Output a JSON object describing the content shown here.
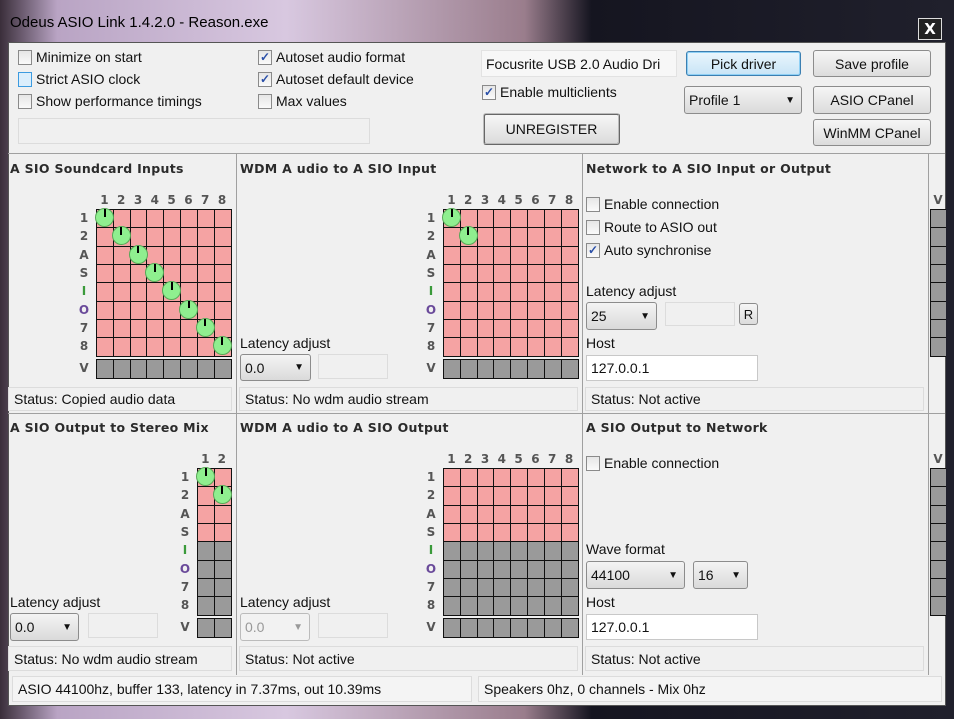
{
  "window": {
    "title": "Odeus ASIO Link 1.4.2.0 - Reason.exe",
    "close_label": "X"
  },
  "options": {
    "minimize_on_start": {
      "label": "Minimize on start",
      "checked": false
    },
    "strict_asio_clock": {
      "label": "Strict ASIO clock",
      "checked": false
    },
    "show_performance_timings": {
      "label": "Show performance timings",
      "checked": false
    },
    "autoset_audio_format": {
      "label": "Autoset audio format",
      "checked": true
    },
    "autoset_default_device": {
      "label": "Autoset default device",
      "checked": true
    },
    "max_values": {
      "label": "Max values",
      "checked": false
    },
    "enable_multiclients": {
      "label": "Enable multiclients",
      "checked": true
    }
  },
  "driver": {
    "name": "Focusrite USB 2.0 Audio Dri",
    "pick_label": "Pick driver",
    "unregister_label": "UNREGISTER",
    "profile": "Profile 1"
  },
  "buttons": {
    "save_profile": "Save profile",
    "asio_cpanel": "ASIO CPanel",
    "winmm_cpanel": "WinMM CPanel"
  },
  "row_labels": [
    "1",
    "2",
    "A",
    "S",
    "I",
    "O",
    "7",
    "8",
    "V"
  ],
  "col_labels": [
    "1",
    "2",
    "3",
    "4",
    "5",
    "6",
    "7",
    "8"
  ],
  "side_col_label": "V",
  "colors": {
    "active": "#f5a3a3",
    "inactive": "#9a9a9a",
    "knob": "#8fef8f"
  },
  "panels": {
    "asio_inputs": {
      "title": "A SIO  Soundcard Inputs",
      "status": "Status: Copied audio data",
      "cols": 8,
      "active_rows": 8,
      "knobs": [
        [
          0,
          0
        ],
        [
          1,
          1
        ],
        [
          2,
          2
        ],
        [
          3,
          3
        ],
        [
          4,
          4
        ],
        [
          5,
          5
        ],
        [
          6,
          6
        ],
        [
          7,
          7
        ]
      ]
    },
    "wdm_to_asio_input": {
      "title": "WDM A udio to A SIO Input",
      "latency_label": "Latency adjust",
      "latency_value": "0.0",
      "status": "Status: No wdm audio stream",
      "cols": 8,
      "active_rows": 8,
      "knobs": [
        [
          0,
          0
        ],
        [
          1,
          1
        ]
      ]
    },
    "network_io": {
      "title": "Network to A SIO Input or Output",
      "enable_connection": {
        "label": "Enable connection",
        "checked": false
      },
      "route_to_asio_out": {
        "label": "Route to ASIO out",
        "checked": false
      },
      "auto_synchronise": {
        "label": "Auto synchronise",
        "checked": true
      },
      "latency_label": "Latency adjust",
      "latency_value": "25",
      "reset_label": "R",
      "host_label": "Host",
      "host_value": "127.0.0.1",
      "status": "Status: Not active",
      "cols": 8,
      "active_rows": 8,
      "knobs": []
    },
    "asio_to_stereo_mix": {
      "title": "A SIO  Output to Stereo Mix",
      "latency_label": "Latency adjust",
      "latency_value": "0.0",
      "status": "Status: No wdm audio stream",
      "cols": 2,
      "active_rows": 4,
      "knobs": [
        [
          0,
          0
        ],
        [
          1,
          1
        ]
      ]
    },
    "wdm_to_asio_output": {
      "title": "WDM A udio to A SIO  Output",
      "latency_label": "Latency adjust",
      "latency_value": "0.0",
      "status": "Status: Not active",
      "cols": 8,
      "active_rows": 4,
      "knobs": []
    },
    "asio_to_network": {
      "title": "A SIO  Output to Network",
      "enable_connection": {
        "label": "Enable connection",
        "checked": false
      },
      "wave_format_label": "Wave format",
      "sample_rate": "44100",
      "bit_depth": "16",
      "host_label": "Host",
      "host_value": "127.0.0.1",
      "status": "Status: Not active",
      "cols": 8,
      "active_rows": 4,
      "knobs": []
    }
  },
  "statusbar": {
    "asio": "ASIO 44100hz, buffer 133, latency in 7.37ms, out 10.39ms",
    "speakers": "Speakers 0hz, 0 channels - Mix 0hz"
  }
}
